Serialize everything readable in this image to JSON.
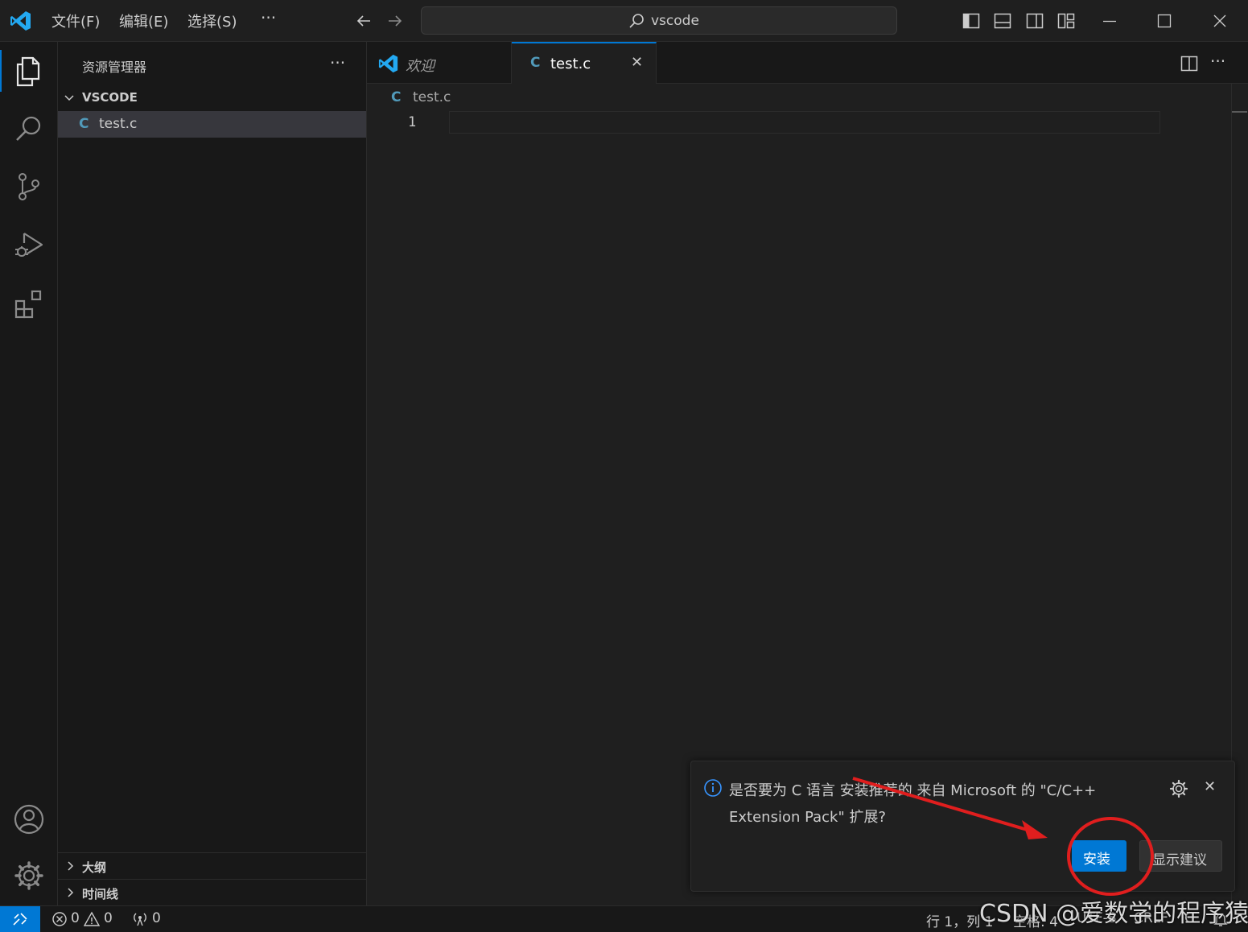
{
  "menu": {
    "file": "文件(F)",
    "edit": "编辑(E)",
    "select": "选择(S)",
    "more": "···"
  },
  "search": {
    "text": "vscode"
  },
  "sidebar": {
    "title": "资源管理器",
    "more": "···",
    "folder": "VSCODE",
    "files": [
      {
        "icon_letter": "C",
        "name": "test.c"
      }
    ],
    "sections": [
      {
        "label": "大纲"
      },
      {
        "label": "时间线"
      }
    ]
  },
  "tabs": [
    {
      "label": "欢迎",
      "italic": true
    },
    {
      "icon_letter": "C",
      "label": "test.c",
      "active": true,
      "close": "✕"
    }
  ],
  "breadcrumb": {
    "icon_letter": "C",
    "label": "test.c"
  },
  "editor": {
    "line_numbers": [
      "1"
    ]
  },
  "notification": {
    "message_line1": "是否要为 C 语言 安装推荐的 来自 Microsoft 的 \"C/C++",
    "message_line2": "Extension Pack\" 扩展?",
    "install_label": "安装",
    "show_label": "显示建议",
    "close": "✕"
  },
  "statusbar": {
    "errors": "0",
    "warnings": "0",
    "ports": "0",
    "cursor": "行 1，列 1",
    "spaces": "空格: 4",
    "encoding": "UTF-8",
    "eol": "CRLF",
    "language": "C"
  },
  "watermark": "CSDN @爱数学的程序猿",
  "colors": {
    "accent": "#0078d4",
    "c_icon": "#519aba",
    "annotation": "#e01e1e",
    "vscode_logo": "#23a9f2"
  },
  "icons": [
    "vscode-logo",
    "arrow-left-icon",
    "arrow-right-icon",
    "search-icon",
    "toggle-sidebar-icon",
    "toggle-panel-icon",
    "toggle-secondary-sidebar-icon",
    "customize-layout-icon",
    "minimize-icon",
    "maximize-icon",
    "close-icon",
    "explorer-icon",
    "search-view-icon",
    "source-control-icon",
    "run-debug-icon",
    "extensions-icon",
    "accounts-icon",
    "manage-gear-icon",
    "chevron-down-icon",
    "chevron-right-icon",
    "split-editor-icon",
    "info-icon",
    "gear-icon",
    "remote-icon",
    "error-icon",
    "warning-icon",
    "broadcast-icon",
    "bell-icon"
  ]
}
